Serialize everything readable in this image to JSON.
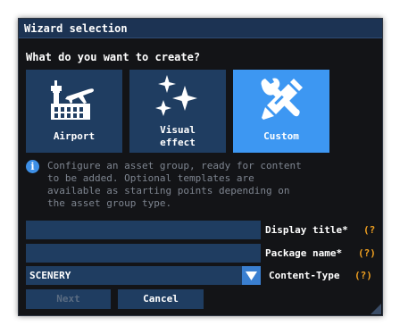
{
  "dialog": {
    "title": "Wizard selection",
    "prompt": "What do you want to create?"
  },
  "tiles": [
    {
      "label": "Airport",
      "icon": "airport-icon",
      "selected": false
    },
    {
      "label": "Visual\neffect",
      "icon": "sparkles-icon",
      "selected": false
    },
    {
      "label": "Custom",
      "icon": "tools-icon",
      "selected": true
    }
  ],
  "info": {
    "icon": "info-icon",
    "text": "Configure an asset group, ready for content\nto be added. Optional templates are\navailable as starting points depending on\nthe asset group type."
  },
  "form": {
    "display_title": {
      "label": "Display title*",
      "value": "",
      "help": "(?"
    },
    "package_name": {
      "label": "Package name*",
      "value": "",
      "help": "(?)"
    },
    "content_type": {
      "label": "Content-Type",
      "value": "SCENERY",
      "help": "(?)"
    }
  },
  "buttons": {
    "next": "Next",
    "cancel": "Cancel"
  },
  "colors": {
    "accent": "#3d97f2",
    "tile": "#1f3d61",
    "help": "#f0a020",
    "background": "#131417"
  }
}
